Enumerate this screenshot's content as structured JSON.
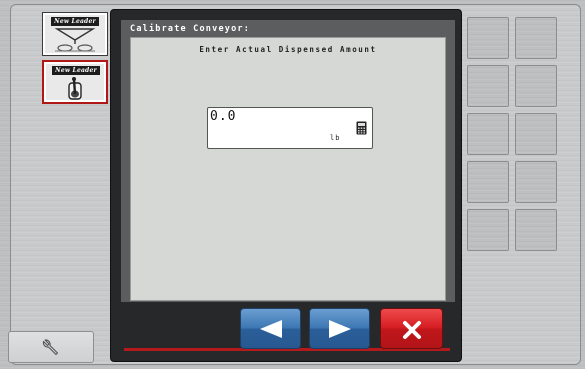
{
  "left_panel": {
    "apps": [
      {
        "logo_text": "New Leader",
        "icon": "spreader-icon",
        "active": false
      },
      {
        "logo_text": "New Leader",
        "icon": "toggle-switch-icon",
        "active": true
      }
    ],
    "settings_icon": "wrench-icon"
  },
  "screen": {
    "title": "Calibrate Conveyor:",
    "prompt": "Enter Actual Dispensed Amount",
    "amount_field": {
      "value": "0.0",
      "unit": "lb",
      "icon": "calculator-icon"
    }
  },
  "footer_buttons": {
    "back_icon": "arrow-left-icon",
    "next_icon": "arrow-right-icon",
    "cancel_icon": "close-icon"
  },
  "softkeys": {
    "rows": 5,
    "cols": 2
  },
  "colors": {
    "nav_blue": "#3d77b3",
    "cancel_red": "#d51d22",
    "active_border": "#b01818",
    "screen_bg": "#d6d8d6"
  }
}
